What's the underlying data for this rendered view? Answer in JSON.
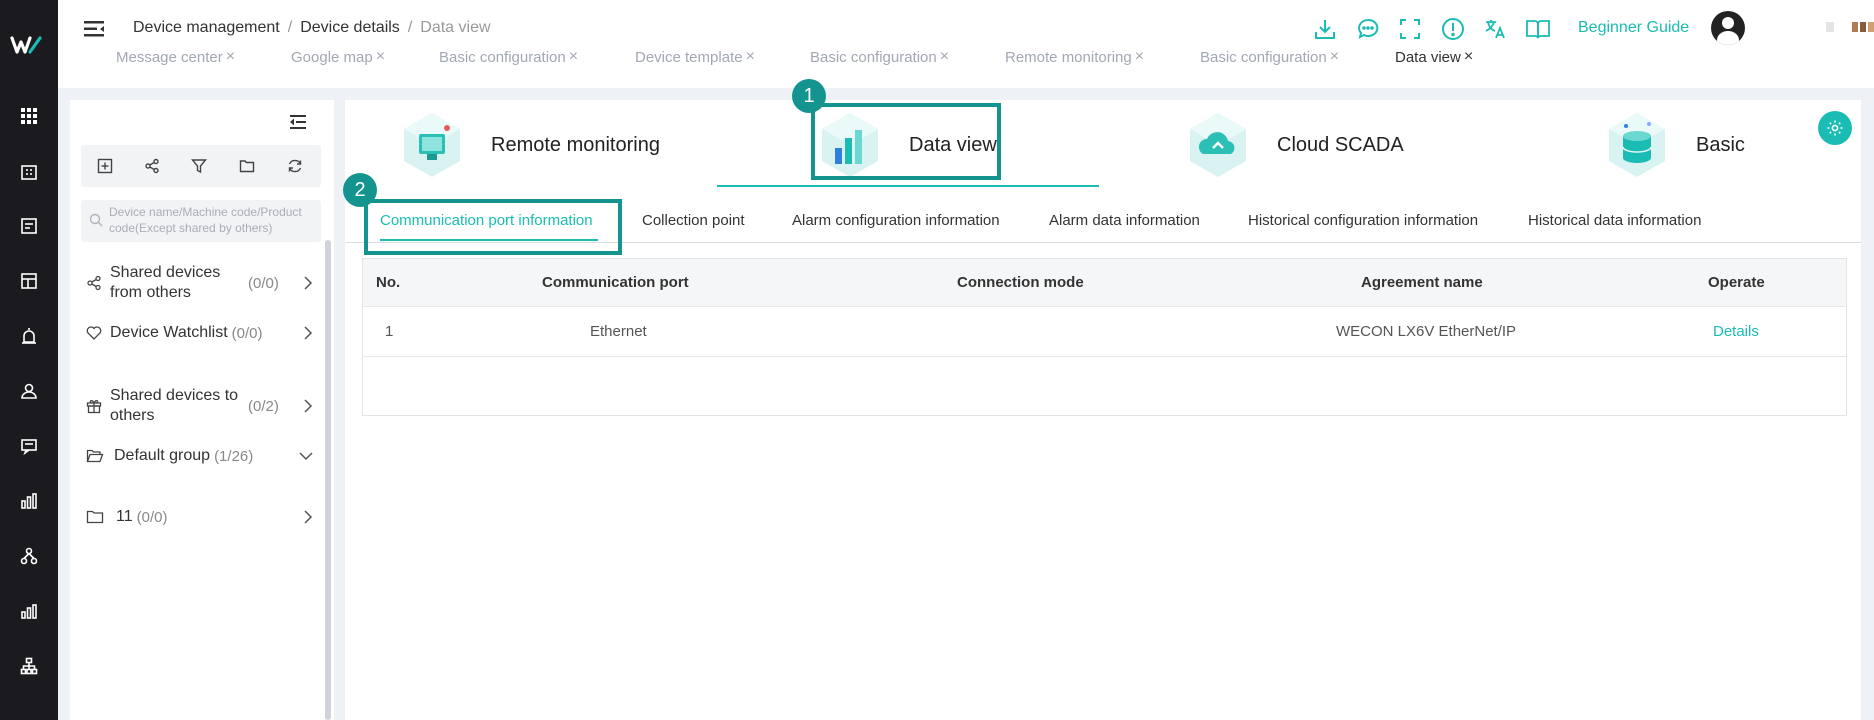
{
  "colors": {
    "accent": "#1abcb4",
    "highlight_box": "#14948f",
    "rail_bg": "#1b1b1f"
  },
  "rail": {
    "icons": [
      "logo-icon",
      "grid-apps-icon",
      "building-icon",
      "document-list-icon",
      "dashboard-layout-icon",
      "alarm-lamp-icon",
      "user-icon",
      "message-board-icon",
      "bar-chart-icon",
      "network-tree-icon",
      "statistics-icon",
      "org-chart-icon"
    ]
  },
  "header": {
    "breadcrumb": [
      "Device management",
      "Device details",
      "Data view"
    ],
    "breadcrumb_sep": "/",
    "icons": [
      "download-icon",
      "chat-icon",
      "fullscreen-icon",
      "alert-circle-icon",
      "translate-icon",
      "help-book-icon"
    ],
    "guide_label": "Beginner Guide",
    "avatar_icon": "avatar-icon"
  },
  "tabs": [
    {
      "label": "Message center",
      "active": false
    },
    {
      "label": "Google map",
      "active": false
    },
    {
      "label": "Basic configuration",
      "active": false
    },
    {
      "label": "Device template",
      "active": false
    },
    {
      "label": "Basic configuration",
      "active": false
    },
    {
      "label": "Remote monitoring",
      "active": false
    },
    {
      "label": "Basic configuration",
      "active": false
    },
    {
      "label": "Data view",
      "active": true
    }
  ],
  "tab_close": "×",
  "side": {
    "toolbar_icons": [
      "add-box-icon",
      "share-icon",
      "filter-icon",
      "folder-icon",
      "refresh-icon"
    ],
    "search_placeholder": "Device name/Machine code/Product code(Except shared by others)",
    "groups": [
      {
        "label": "Shared devices from others",
        "count": "(0/0)",
        "icon": "share-icon",
        "chevron": "chevron-right-icon"
      },
      {
        "label": "Device Watchlist",
        "count": "(0/0)",
        "icon": "heart-icon",
        "chevron": "chevron-right-icon"
      },
      {
        "label": "Shared devices to others",
        "count": "(0/2)",
        "icon": "gift-icon",
        "chevron": "chevron-right-icon"
      },
      {
        "label": "Default group",
        "count": "(1/26)",
        "icon": "folder-open-icon",
        "chevron": "chevron-down-icon"
      },
      {
        "label": "11",
        "count": "(0/0)",
        "icon": "folder-icon",
        "chevron": "chevron-right-icon"
      }
    ]
  },
  "modules": [
    {
      "label": "Remote monitoring",
      "active": false
    },
    {
      "label": "Data view",
      "active": true
    },
    {
      "label": "Cloud SCADA",
      "active": false
    },
    {
      "label": "Basic",
      "active": false
    }
  ],
  "badges": [
    "1",
    "2"
  ],
  "subtabs": [
    {
      "label": "Communication port information",
      "active": true
    },
    {
      "label": "Collection point",
      "active": false
    },
    {
      "label": "Alarm configuration information",
      "active": false
    },
    {
      "label": "Alarm data information",
      "active": false
    },
    {
      "label": "Historical configuration information",
      "active": false
    },
    {
      "label": "Historical data information",
      "active": false
    }
  ],
  "table": {
    "columns": [
      "No.",
      "Communication port",
      "Connection mode",
      "Agreement name",
      "Operate"
    ],
    "rows": [
      {
        "no": "1",
        "port": "Ethernet",
        "mode": "",
        "agreement": "WECON LX6V EtherNet/IP",
        "operate": "Details"
      }
    ]
  }
}
